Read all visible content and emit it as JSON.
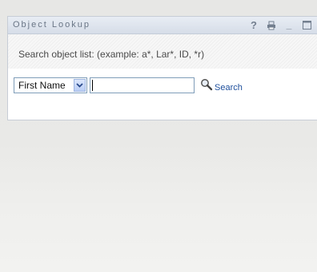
{
  "portlet": {
    "title": "Object Lookup",
    "toolbar": {
      "help_icon": "help-icon",
      "print_icon": "print-icon",
      "minimize_icon": "minimize-icon",
      "maximize_icon": "maximize-icon",
      "help_glyph": "?",
      "minimize_glyph": "_"
    }
  },
  "lookup": {
    "description": "Search object list: (example: a*, Lar*, ID, *r)",
    "attribute_select": {
      "selected": "First Name"
    },
    "search_input": {
      "value": "",
      "placeholder": ""
    },
    "search_label": "Search"
  },
  "colors": {
    "titlebar": "#d6dde8",
    "title_text": "#6a7686",
    "link": "#1e4f9c",
    "input_border": "#7f9db9"
  }
}
